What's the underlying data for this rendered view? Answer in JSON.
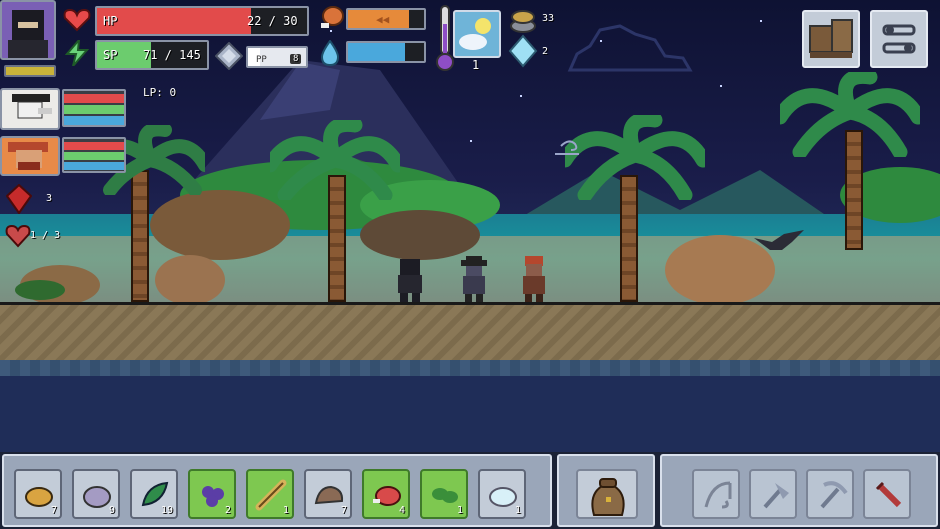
{
  "hud": {
    "hp_label": "HP",
    "hp_value": "22 / 30",
    "hp_fraction": 0.733,
    "sp_label": "SP",
    "sp_value": "71 / 145",
    "sp_fraction": 0.49,
    "pp_label": "PP",
    "pp_badge": "8",
    "pp_fraction": 0.2,
    "hunger_fraction": 0.8,
    "thirst_fraction": 0.75,
    "temperature_level": "1",
    "coin_count": "33",
    "gem_count": "2",
    "lp_label": "LP: 0",
    "red_gem_count": "3",
    "hearts_value": "1 / 3"
  },
  "party": [
    {
      "name": "player-portrait-ninja"
    },
    {
      "name": "party-member-plague-doctor"
    },
    {
      "name": "party-member-red-haired"
    }
  ],
  "menu_buttons": [
    {
      "name": "inventory-chest-button",
      "icon": "chest-icon"
    },
    {
      "name": "settings-button",
      "icon": "sliders-icon"
    }
  ],
  "hotbar": {
    "items": [
      {
        "icon": "bread-icon",
        "qty": "7",
        "selected": false,
        "color": "#d9a441"
      },
      {
        "icon": "stone-icon",
        "qty": "9",
        "selected": false,
        "color": "#a49bc3"
      },
      {
        "icon": "herb-icon",
        "qty": "19",
        "selected": false,
        "color": "#2f8c4a"
      },
      {
        "icon": "berries-icon",
        "qty": "2",
        "selected": true,
        "color": "#5b3ea6"
      },
      {
        "icon": "stick-icon",
        "qty": "1",
        "selected": true,
        "color": "#d6b35a"
      },
      {
        "icon": "rock-icon",
        "qty": "7",
        "selected": false,
        "color": "#8a6a55"
      },
      {
        "icon": "meat-icon",
        "qty": "4",
        "selected": true,
        "color": "#d84a4a"
      },
      {
        "icon": "leaves-icon",
        "qty": "1",
        "selected": true,
        "color": "#3a8f3a"
      },
      {
        "icon": "crystal-icon",
        "qty": "1",
        "selected": false,
        "color": "#d8f0f8"
      }
    ],
    "bag_icon": "backpack-icon",
    "tools": [
      {
        "icon": "fishing-rod-icon"
      },
      {
        "icon": "axe-icon"
      },
      {
        "icon": "pickaxe-icon"
      },
      {
        "icon": "sword-icon"
      }
    ]
  }
}
